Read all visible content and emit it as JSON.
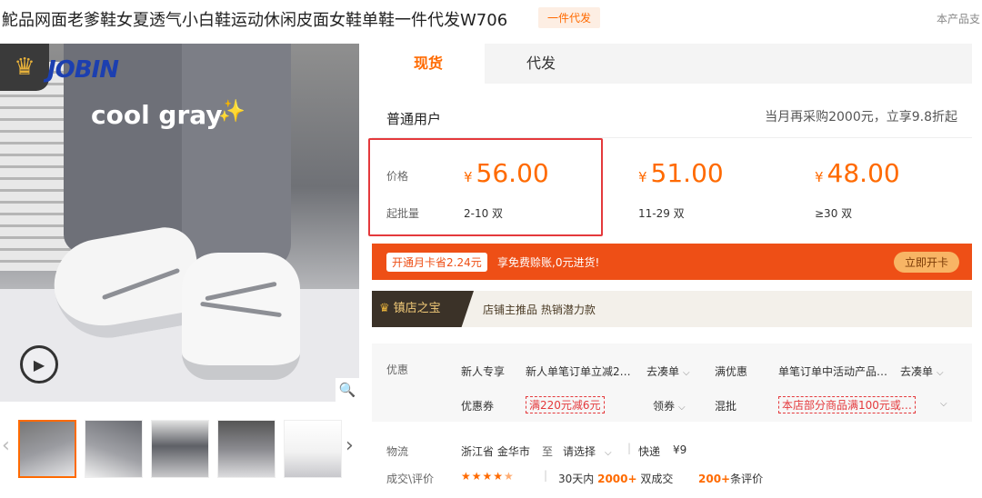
{
  "header": {
    "title": "鮀品网面老爹鞋女夏透气小白鞋运动休闲皮面女鞋单鞋一件代发W706",
    "dropship_tag": "一件代发",
    "support_text": "本产品支"
  },
  "gallery": {
    "brand_text": "JOBIN",
    "overlay_text": "cool gray",
    "thumb_count": 5,
    "active_thumb": 0
  },
  "tabs": [
    {
      "label": "现货",
      "active": true
    },
    {
      "label": "代发",
      "active": false
    }
  ],
  "pricing": {
    "user_type": "普通用户",
    "promo": "当月再采购2000元，立享9.8折起",
    "price_label": "价格",
    "moq_label": "起批量",
    "currency": "¥",
    "tiers": [
      {
        "price": "56.00",
        "qty": "2-10 双"
      },
      {
        "price": "51.00",
        "qty": "11-29 双"
      },
      {
        "price": "48.00",
        "qty": "≥30 双"
      }
    ]
  },
  "member": {
    "badge": "开通月卡省2.24元",
    "text": "享免费赊账,0元进货!",
    "button": "立即开卡"
  },
  "treasure": {
    "tag": "镇店之宝",
    "text": "店铺主推品  热销潜力款"
  },
  "offers": {
    "label": "优惠",
    "row1": [
      {
        "tag": "新人专享",
        "desc": "新人单笔订单立减2…",
        "action": "去凑单"
      },
      {
        "tag": "满优惠",
        "desc": "单笔订单中活动产品…",
        "action": "去凑单"
      }
    ],
    "row2": [
      {
        "tag": "优惠券",
        "coupon": "满220元减6元",
        "action": "领券"
      },
      {
        "tag": "混批",
        "coupon": "本店部分商品满100元或…"
      }
    ]
  },
  "logistics": {
    "label": "物流",
    "from": "浙江省 金华市",
    "to_word": "至",
    "select": "请选择",
    "express": "快递",
    "fee": "¥9"
  },
  "reviews": {
    "label": "成交\\评价",
    "rating": 4.5,
    "days_prefix": "30天内",
    "sold": "2000+",
    "sold_suffix": "双成交",
    "reviews": "200+",
    "reviews_suffix": "条评价"
  },
  "colors": {
    "accent": "#ff6a00",
    "red": "#e4393c",
    "member_bar": "#ee4f16"
  },
  "icons": [
    "crown-icon",
    "sparkle-icon",
    "play-icon",
    "zoom-icon",
    "chevron-left-icon",
    "chevron-right-icon",
    "chevron-down-icon",
    "star-icon"
  ]
}
